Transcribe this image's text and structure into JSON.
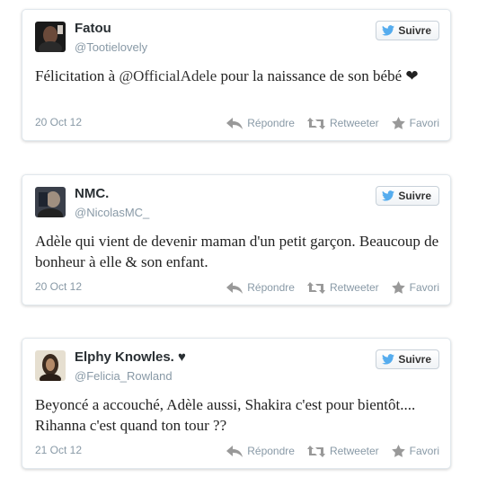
{
  "colors": {
    "twitter_blue": "#55acee",
    "muted": "#8899a6"
  },
  "tweets": [
    {
      "name": "Fatou",
      "handle": "@Tootielovely",
      "follow_label": "Suivre",
      "text_before": "Félicitation à ",
      "mention": "@OfficialAdele",
      "text_after": " pour la naissance de son bébé ❤",
      "date": "20 Oct 12",
      "reply_label": "Répondre",
      "retweet_label": "Retweeter",
      "favorite_label": "Favori"
    },
    {
      "name": "NMC.",
      "handle": "@NicolasMC_",
      "follow_label": "Suivre",
      "text_before": "Adèle qui vient de devenir maman d'un petit garçon. Beaucoup de bonheur à elle & son enfant.",
      "mention": "",
      "text_after": "",
      "date": "20 Oct 12",
      "reply_label": "Répondre",
      "retweet_label": "Retweeter",
      "favorite_label": "Favori"
    },
    {
      "name": "Elphy Knowles. ♥",
      "handle": "@Felicia_Rowland",
      "follow_label": "Suivre",
      "text_before": "Beyoncé a accouché, Adèle aussi, Shakira c'est pour bientôt.... Rihanna c'est quand ton tour ??",
      "mention": "",
      "text_after": "",
      "date": "21 Oct 12",
      "reply_label": "Répondre",
      "retweet_label": "Retweeter",
      "favorite_label": "Favori"
    }
  ]
}
